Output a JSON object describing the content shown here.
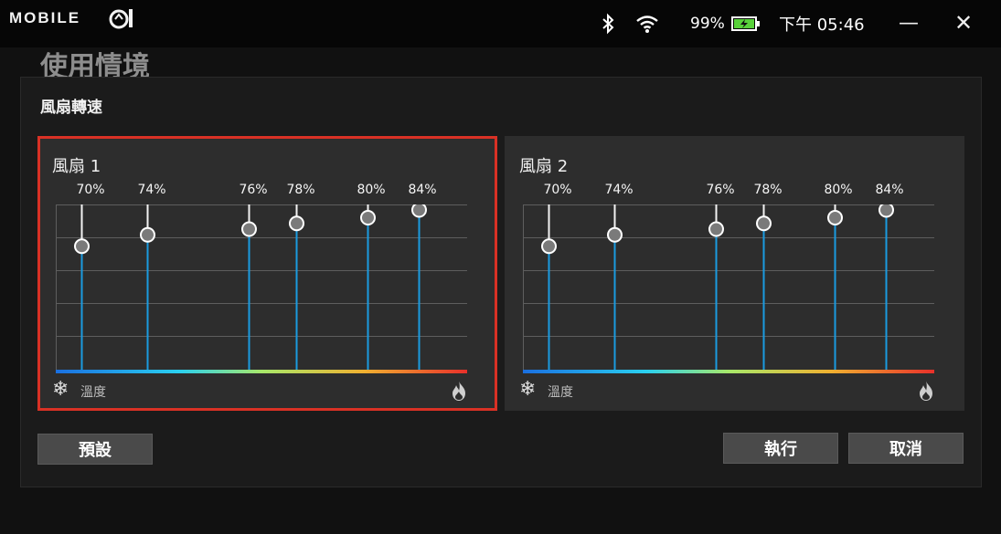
{
  "header": {
    "logo": "MOBILE",
    "battery_pct": "99%",
    "clock": "下午 05:46",
    "minimize_glyph": "—",
    "close_glyph": "✕",
    "icons": [
      "bluetooth-icon",
      "wifi-icon",
      "battery-charging-icon",
      "mobile01-logo-icon"
    ]
  },
  "page_title": "使用情境",
  "panel": {
    "title": "風扇轉速",
    "temperature_label": "溫度",
    "default_button": "預設",
    "apply_button": "執行",
    "cancel_button": "取消",
    "fans": [
      {
        "name": "風扇 1",
        "selected": true,
        "points": [
          {
            "label": "70%",
            "value": 70
          },
          {
            "label": "74%",
            "value": 74
          },
          {
            "label": "76%",
            "value": 76
          },
          {
            "label": "78%",
            "value": 78
          },
          {
            "label": "80%",
            "value": 80
          },
          {
            "label": "84%",
            "value": 84
          }
        ]
      },
      {
        "name": "風扇 2",
        "selected": false,
        "points": [
          {
            "label": "70%",
            "value": 70
          },
          {
            "label": "74%",
            "value": 74
          },
          {
            "label": "76%",
            "value": 76
          },
          {
            "label": "78%",
            "value": 78
          },
          {
            "label": "80%",
            "value": 80
          },
          {
            "label": "84%",
            "value": 84
          }
        ]
      }
    ]
  },
  "colors": {
    "accent_blue": "#1a9be0",
    "selected_border": "#d93125",
    "battery_green": "#58d13a"
  }
}
